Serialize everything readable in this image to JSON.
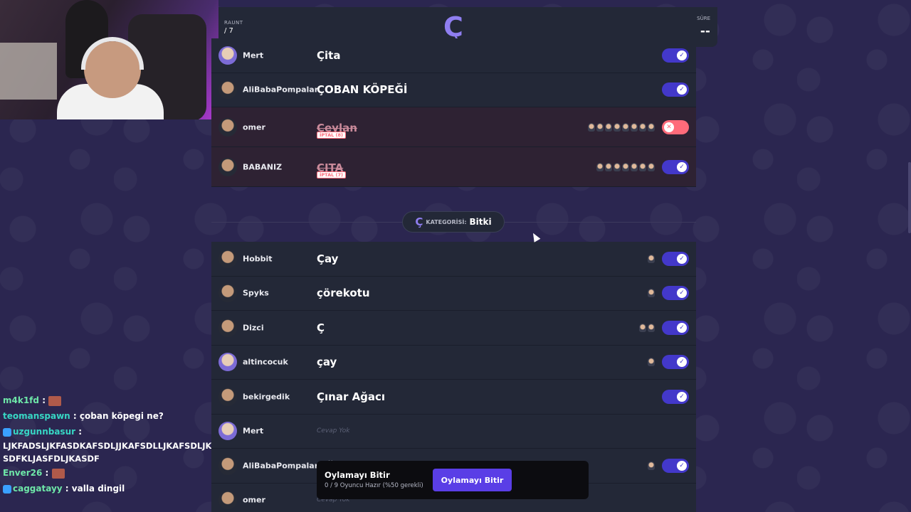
{
  "header": {
    "round_label": "RAUNT",
    "round_value": "/ 7",
    "letter": "Ç",
    "time_label": "SÜRE",
    "time_value": "--"
  },
  "prev_rows": [
    {
      "name": "Mert",
      "answer": "Çita",
      "status": "accepted",
      "voters": 0,
      "avatar": "purple"
    },
    {
      "name": "AliBabaPompalar",
      "answer": "ÇOBAN KÖPEĞİ",
      "status": "accepted",
      "voters": 0,
      "avatar": "dark"
    },
    {
      "name": "omer",
      "answer": "Çeylan",
      "status": "rejected",
      "iptal": "İPTAL (8)",
      "voters": 8,
      "avatar": "dark"
    },
    {
      "name": "BABANIZ",
      "answer": "ÇITA",
      "status": "accepted-disputed",
      "iptal": "İPTAL (7)",
      "voters": 7,
      "avatar": "dark"
    }
  ],
  "category": {
    "letter": "Ç",
    "label": "KATEGORİSİ:",
    "value": "Bitki"
  },
  "rows": [
    {
      "name": "Hobbit",
      "answer": "Çay",
      "status": "accepted",
      "voters": 1,
      "avatar": "dark"
    },
    {
      "name": "Spyks",
      "answer": "çörekotu",
      "status": "accepted",
      "voters": 1,
      "avatar": "dark"
    },
    {
      "name": "Dizci",
      "answer": "Ç",
      "status": "accepted",
      "voters": 2,
      "avatar": "dark"
    },
    {
      "name": "altincocuk",
      "answer": "çay",
      "status": "accepted",
      "voters": 1,
      "avatar": "purple"
    },
    {
      "name": "bekirgedik",
      "answer": "Çınar Ağacı",
      "status": "accepted",
      "voters": 0,
      "avatar": "dark"
    },
    {
      "name": "Mert",
      "answer": "Cevap Yok",
      "status": "empty",
      "voters": 0,
      "avatar": "purple"
    },
    {
      "name": "AliBabaPompalar",
      "answer": "çiğ",
      "status": "accepted",
      "voters": 1,
      "avatar": "dark"
    },
    {
      "name": "omer",
      "answer": "Cevap Yok",
      "status": "empty",
      "voters": 0,
      "avatar": "dark"
    }
  ],
  "vote_bar": {
    "title": "Oylamayı Bitir",
    "subtitle": "0 / 9 Oyuncu Hazır (%50 gerekli)",
    "button": "Oylamayı Bitir"
  },
  "chat": [
    {
      "user": "m4k1fd",
      "text": ":",
      "color": "green",
      "emote": true
    },
    {
      "user": "teomanspawn",
      "text": ": çoban köpegi ne?",
      "color": "teal"
    },
    {
      "user": "uzgunnbasur",
      "text": ":",
      "color": "teal",
      "badge": true
    },
    {
      "user": "",
      "text": "LJKFADSLJKFASDKAFSDLJJKAFSDLLJKAFSDLJKA",
      "long": true
    },
    {
      "user": "",
      "text": "SDFKLJASFDLJKASDF",
      "long": true
    },
    {
      "user": "Enver26",
      "text": ":",
      "color": "green",
      "emote": true
    },
    {
      "user": "caggatayy",
      "text": ": valla dingil",
      "color": "green",
      "badge": true
    }
  ],
  "colors": {
    "accent": "#4338ca",
    "letter": "#8f7ef0",
    "reject": "#ff6b7a",
    "card": "#232837",
    "background": "#2b2650"
  }
}
